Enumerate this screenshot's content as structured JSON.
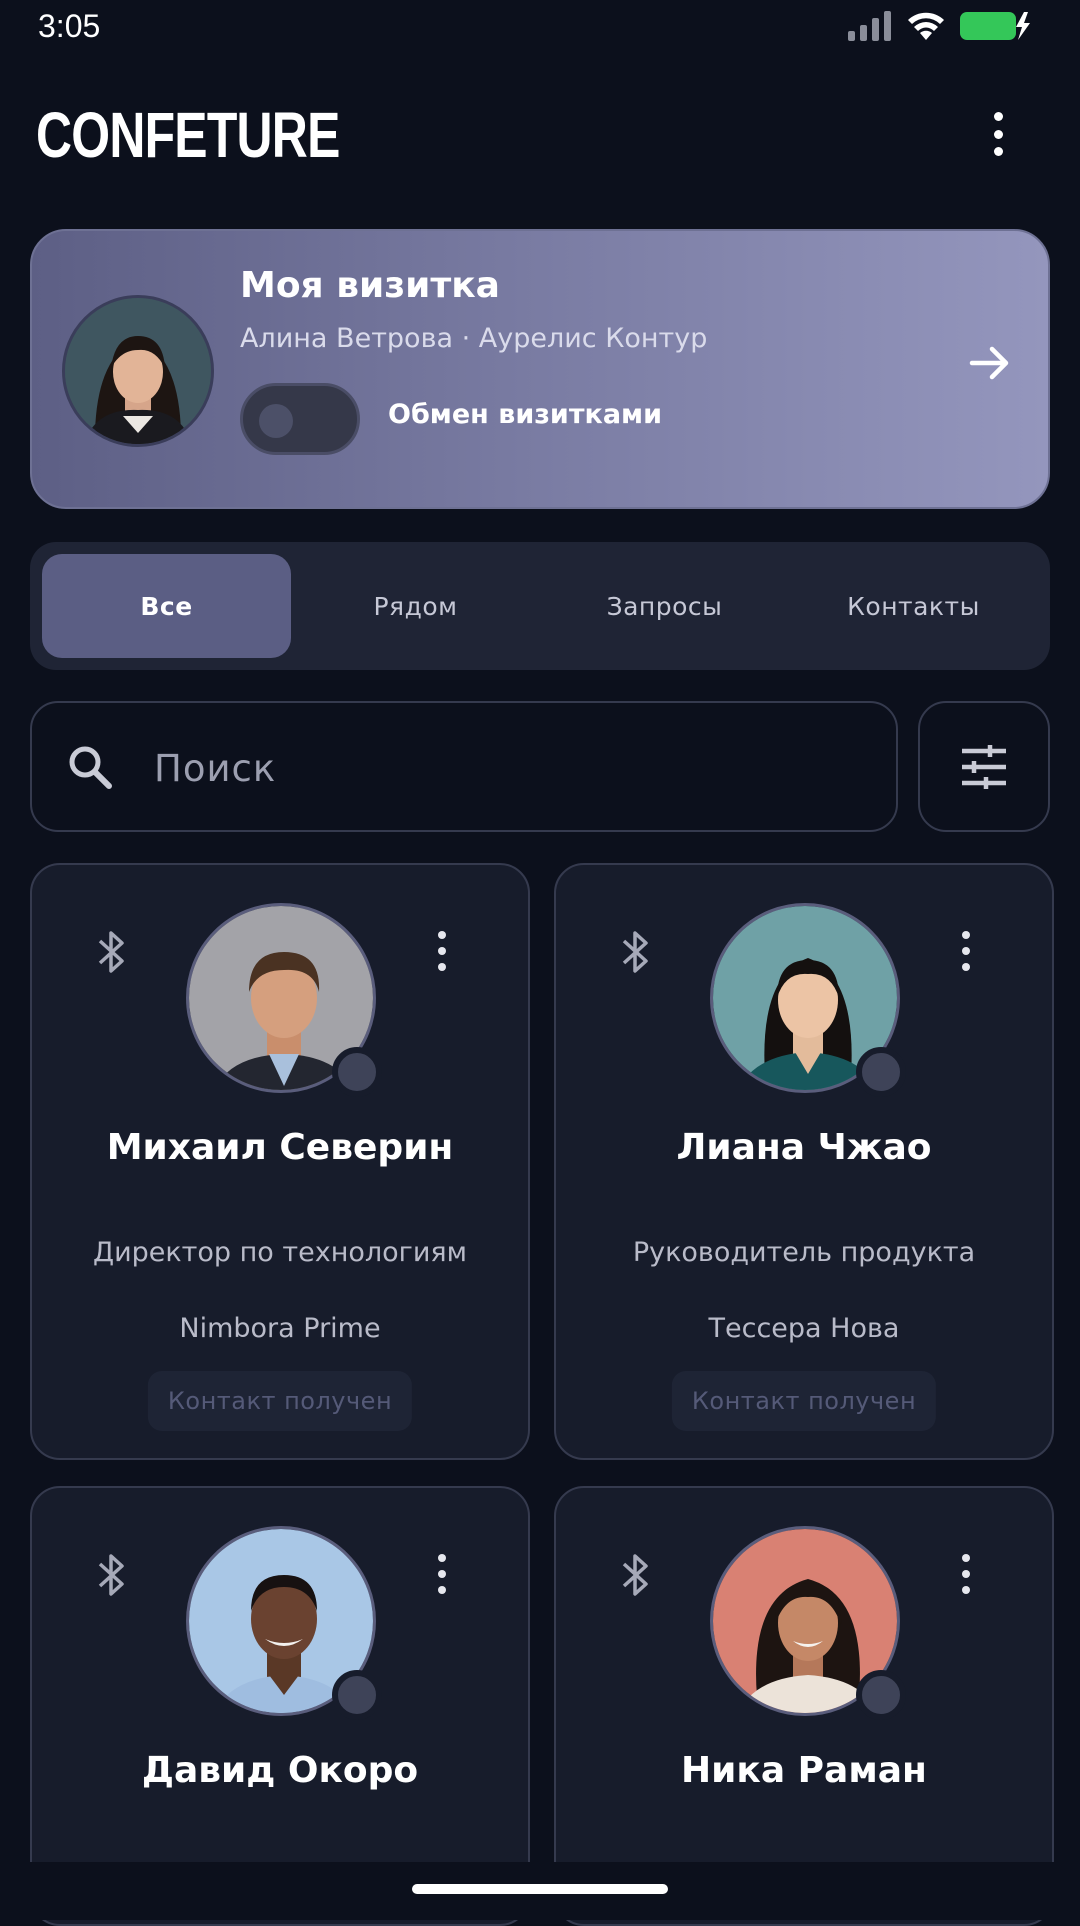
{
  "status": {
    "time": "3:05"
  },
  "app": {
    "brand": "CONFETURE"
  },
  "my_card": {
    "title": "Моя визитка",
    "subtitle": "Алина Ветрова · Аурелис Контур",
    "exchange_label": "Обмен визитками",
    "exchange_enabled": false
  },
  "tabs": [
    {
      "label": "Все",
      "active": true
    },
    {
      "label": "Рядом",
      "active": false
    },
    {
      "label": "Запросы",
      "active": false
    },
    {
      "label": "Контакты",
      "active": false
    }
  ],
  "search": {
    "placeholder": "Поиск",
    "value": ""
  },
  "contacts": [
    {
      "name": "Михаил Северин",
      "role": "Директор по технологиям",
      "company": "Nimbora Prime",
      "status": "Контакт получен"
    },
    {
      "name": "Лиана Чжао",
      "role": "Руководитель продукта",
      "company": "Тессера Нова",
      "status": "Контакт получен"
    },
    {
      "name": "Давид Окоро",
      "role": "",
      "company": "",
      "status": ""
    },
    {
      "name": "Ника Раман",
      "role": "",
      "company": "",
      "status": ""
    }
  ],
  "colors": {
    "background": "#0c101c",
    "accent": "#5b5e84",
    "battery": "#34c759"
  }
}
